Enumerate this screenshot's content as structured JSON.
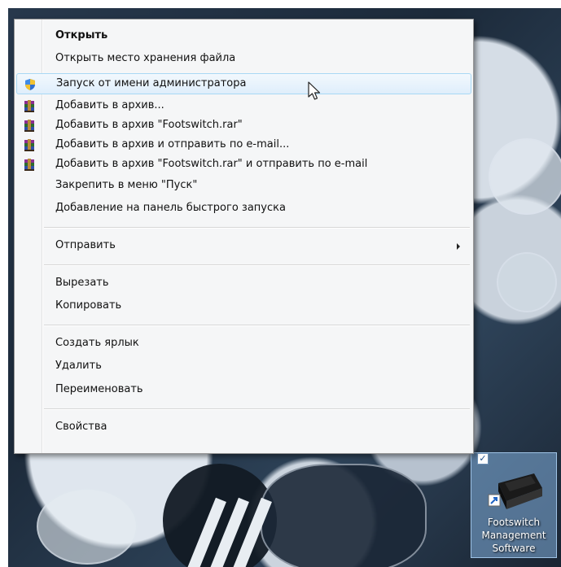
{
  "menu": {
    "items": [
      {
        "label": "Открыть",
        "bold": true
      },
      {
        "label": "Открыть место хранения файла"
      },
      {
        "label": "Запуск от имени администратора",
        "icon": "uac-shield-icon",
        "hover": true
      },
      {
        "label": "Добавить в архив...",
        "icon": "winrar-icon"
      },
      {
        "label": "Добавить в архив \"Footswitch.rar\"",
        "icon": "winrar-icon"
      },
      {
        "label": "Добавить в архив и отправить по e-mail...",
        "icon": "winrar-icon"
      },
      {
        "label": "Добавить в архив \"Footswitch.rar\" и отправить по e-mail",
        "icon": "winrar-icon"
      },
      {
        "label": "Закрепить в меню \"Пуск\""
      },
      {
        "label": "Добавление на панель быстрого запуска"
      },
      {
        "label": "Отправить",
        "submenu": true
      },
      {
        "label": "Вырезать"
      },
      {
        "label": "Копировать"
      },
      {
        "label": "Создать ярлык"
      },
      {
        "label": "Удалить"
      },
      {
        "label": "Переименовать"
      },
      {
        "label": "Свойства"
      }
    ]
  },
  "desktop_icon": {
    "label_line1": "Footswitch",
    "label_line2": "Management",
    "label_line3": "Software",
    "checked_mark": "✓",
    "icon": "footswitch-shortcut-icon"
  },
  "colors": {
    "hover_border": "#a8d8f5",
    "menu_bg": "#f5f6f7"
  }
}
